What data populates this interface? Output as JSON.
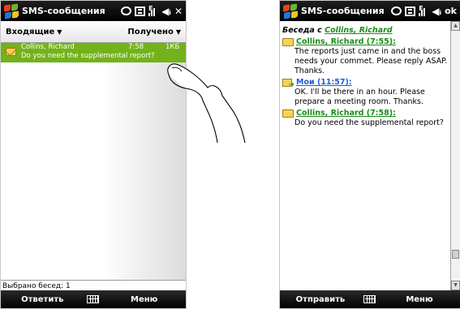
{
  "left_screen": {
    "title": "SMS-сообщения",
    "status_icons": [
      "message-bubble-icon",
      "inbox-icon",
      "signal-edge-icon",
      "speaker-icon"
    ],
    "close_label": "✕",
    "folder_label": "Входящие",
    "sort_label": "Получено",
    "messages": [
      {
        "from": "Collins, Richard",
        "time": "7:58",
        "size": "1КБ",
        "preview": "Do you need the supplemental report?"
      }
    ],
    "status_text": "Выбрано бесед: 1",
    "softkey_left": "Ответить",
    "softkey_right": "Меню"
  },
  "right_screen": {
    "title": "SMS-сообщения",
    "ok_label": "ok",
    "convo_prefix": "Беседа с ",
    "convo_contact": "Collins, Richard",
    "messages": [
      {
        "kind": "received",
        "sender": "Collins, Richard (7:55):",
        "text": "The reports just came in and the boss needs your commet. Please reply ASAP. Thanks."
      },
      {
        "kind": "sent",
        "sender": "Мои (11:57):",
        "text": "OK. I'll be there in an hour. Please prepare a meeting room. Thanks."
      },
      {
        "kind": "received",
        "sender": "Collins, Richard (7:58):",
        "text": "Do you need the supplemental report?"
      }
    ],
    "softkey_left": "Отправить",
    "softkey_right": "Меню"
  },
  "colors": {
    "selection_green": "#73b21b",
    "link_green": "#1a8a1a",
    "link_blue": "#1f5fd6",
    "bar_black": "#000000"
  }
}
